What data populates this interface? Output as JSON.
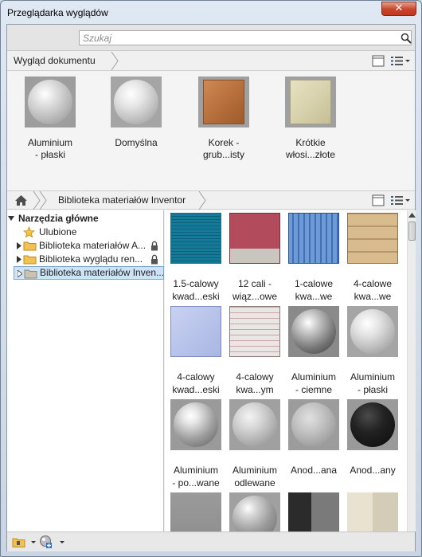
{
  "window": {
    "title": "Przeglądarka wyglądów",
    "close_label": "✕"
  },
  "search": {
    "placeholder": "Szukaj",
    "value": ""
  },
  "document_bar": {
    "breadcrumb": "Wygląd dokumentu"
  },
  "document_appearances": [
    {
      "label_line1": "Aluminium",
      "label_line2": "- płaski",
      "icon": "sphere-matte"
    },
    {
      "label_line1": "Domyślna",
      "label_line2": "",
      "icon": "sphere-default"
    },
    {
      "label_line1": "Korek -",
      "label_line2": "grub...isty",
      "icon": "cube-cork"
    },
    {
      "label_line1": "Krótkie",
      "label_line2": "włosi...złote",
      "icon": "cube-carpet"
    }
  ],
  "library_bar": {
    "home_icon": "home-icon",
    "breadcrumb": "Biblioteka materiałów Inventor"
  },
  "tree": {
    "root": "Narzędzia główne",
    "items": [
      {
        "label": "Ulubione",
        "icon": "star-icon"
      },
      {
        "label": "Biblioteka materiałów A...",
        "icon": "folder-icon",
        "locked": true
      },
      {
        "label": "Biblioteka wyglądu ren...",
        "icon": "folder-icon",
        "locked": true
      },
      {
        "label": "Biblioteka materiałów Inven...",
        "icon": "folder-icon",
        "selected": true
      }
    ]
  },
  "library_items": [
    {
      "line1": "1.5-calowy",
      "line2": "kwad...eski",
      "icon": "tile-teal"
    },
    {
      "line1": "12 cali -",
      "line2": "wiąz...owe",
      "icon": "tile-red-wall"
    },
    {
      "line1": "1-calowe",
      "line2": "kwa...we",
      "icon": "tile-blue-mosaic"
    },
    {
      "line1": "4-calowe",
      "line2": "kwa...we",
      "icon": "tile-beige"
    },
    {
      "line1": "4-calowy",
      "line2": "kwad...eski",
      "icon": "tile-lavender"
    },
    {
      "line1": "4-calowy",
      "line2": "kwa...ym",
      "icon": "tile-white-grid"
    },
    {
      "line1": "Aluminium",
      "line2": "- ciemne",
      "icon": "sphere-dark-chrome"
    },
    {
      "line1": "Aluminium",
      "line2": "- płaski",
      "icon": "sphere-flat"
    },
    {
      "line1": "Aluminium",
      "line2": "- po...wane",
      "icon": "sphere-polished"
    },
    {
      "line1": "Aluminium",
      "line2": "odlewane",
      "icon": "sphere-cast"
    },
    {
      "line1": "Anod...ana",
      "line2": "",
      "icon": "sphere-anodized"
    },
    {
      "line1": "Anod...any",
      "line2": "",
      "icon": "sphere-black"
    }
  ],
  "colors": {
    "selection": "#cde3f8",
    "accent_close": "#c8442b"
  }
}
